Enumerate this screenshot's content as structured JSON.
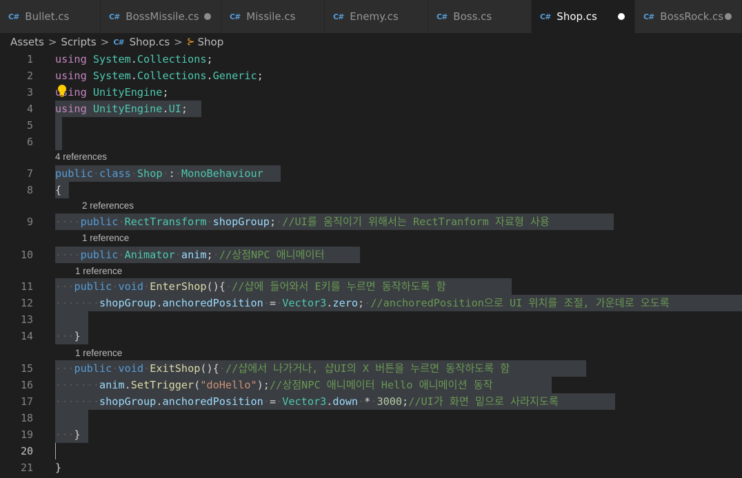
{
  "tabs": [
    {
      "label": "Bullet.cs",
      "modified": false,
      "active": false
    },
    {
      "label": "BossMissile.cs",
      "modified": true,
      "active": false
    },
    {
      "label": "Missile.cs",
      "modified": false,
      "active": false
    },
    {
      "label": "Enemy.cs",
      "modified": false,
      "active": false
    },
    {
      "label": "Boss.cs",
      "modified": false,
      "active": false
    },
    {
      "label": "Shop.cs",
      "modified": true,
      "active": true
    },
    {
      "label": "BossRock.cs",
      "modified": true,
      "active": false
    }
  ],
  "tab_icon_glyph": "C#",
  "breadcrumb": {
    "items": [
      "Assets",
      "Scripts",
      "Shop.cs",
      "Shop"
    ],
    "separator": ">",
    "class_icon": "⊱"
  },
  "code_lens": {
    "l7": "4 references",
    "l9": "2 references",
    "l10": "1 reference",
    "l11": "1 reference",
    "l15": "1 reference"
  },
  "line_numbers": [
    "1",
    "2",
    "3",
    "4",
    "5",
    "6",
    "7",
    "8",
    "9",
    "10",
    "11",
    "12",
    "13",
    "14",
    "15",
    "16",
    "17",
    "18",
    "19",
    "20",
    "21"
  ],
  "current_line": "20",
  "code": {
    "l1": {
      "kw": "using",
      "ns1": "System",
      "dot": ".",
      "ns2": "Collections",
      "end": ";"
    },
    "l2": {
      "kw": "using",
      "ns1": "System",
      "dot1": ".",
      "ns2": "Collections",
      "dot2": ".",
      "ns3": "Generic",
      "end": ";"
    },
    "l3": {
      "kw": "using",
      "ns1": "UnityEngine",
      "end": ";"
    },
    "l4": {
      "kw": "using",
      "ns1": "UnityEngine",
      "dot": ".",
      "ns2": "UI",
      "end": ";"
    },
    "l7": {
      "kw1": "public",
      "kw2": "class",
      "cls": "Shop",
      "colon": ":",
      "base": "MonoBehaviour"
    },
    "l8": {
      "brace": "{"
    },
    "l9": {
      "kw": "public",
      "type": "RectTransform",
      "var": "shopGroup",
      "end": ";",
      "cmt": "//UI를 움직이기 위해서는 RectTranform 자료형 사용"
    },
    "l10": {
      "kw": "public",
      "type": "Animator",
      "var": "anim",
      "end": ";",
      "cmt": "//상점NPC 애니메이터"
    },
    "l11": {
      "kw1": "public",
      "kw2": "void",
      "fn": "EnterShop",
      "paren": "(){",
      "cmt": "//샵에 들어와서 E키를 누르면 동작하도록 함"
    },
    "l12": {
      "var1": "shopGroup",
      "dot1": ".",
      "var2": "anchoredPosition",
      "eq": "=",
      "type": "Vector3",
      "dot2": ".",
      "var3": "zero",
      "end": ";",
      "cmt": "//anchoredPosition으로 UI 위치를 조절, 가운데로 오도록"
    },
    "l14": {
      "brace": "}"
    },
    "l15": {
      "kw1": "public",
      "kw2": "void",
      "fn": "ExitShop",
      "paren": "(){",
      "cmt": "//샵에서 나가거나, 샵UI의 X 버튼을 누르면 동작하도록 함"
    },
    "l16": {
      "var": "anim",
      "dot": ".",
      "fn": "SetTrigger",
      "open": "(",
      "str": "\"doHello\"",
      "close": ");",
      "cmt": "//상점NPC 애니메이터 Hello 애니메이션 동작"
    },
    "l17": {
      "var1": "shopGroup",
      "dot1": ".",
      "var2": "anchoredPosition",
      "eq": "=",
      "type": "Vector3",
      "dot2": ".",
      "var3": "down",
      "op": "*",
      "num": "3000",
      "end": ";",
      "cmt": "//UI가 화면 밑으로 사라지도록"
    },
    "l19": {
      "brace": "}"
    },
    "l21": {
      "brace": "}"
    }
  },
  "colors": {
    "editor_bg": "#1e1e1e",
    "tabbar_bg": "#252526",
    "keyword": "#569cd6",
    "type": "#4ec9b0",
    "comment": "#6a9955",
    "function": "#dcdcaa",
    "variable": "#9cdcfe",
    "string": "#ce9178",
    "number": "#b5cea8",
    "selection": "#3a3d41"
  }
}
